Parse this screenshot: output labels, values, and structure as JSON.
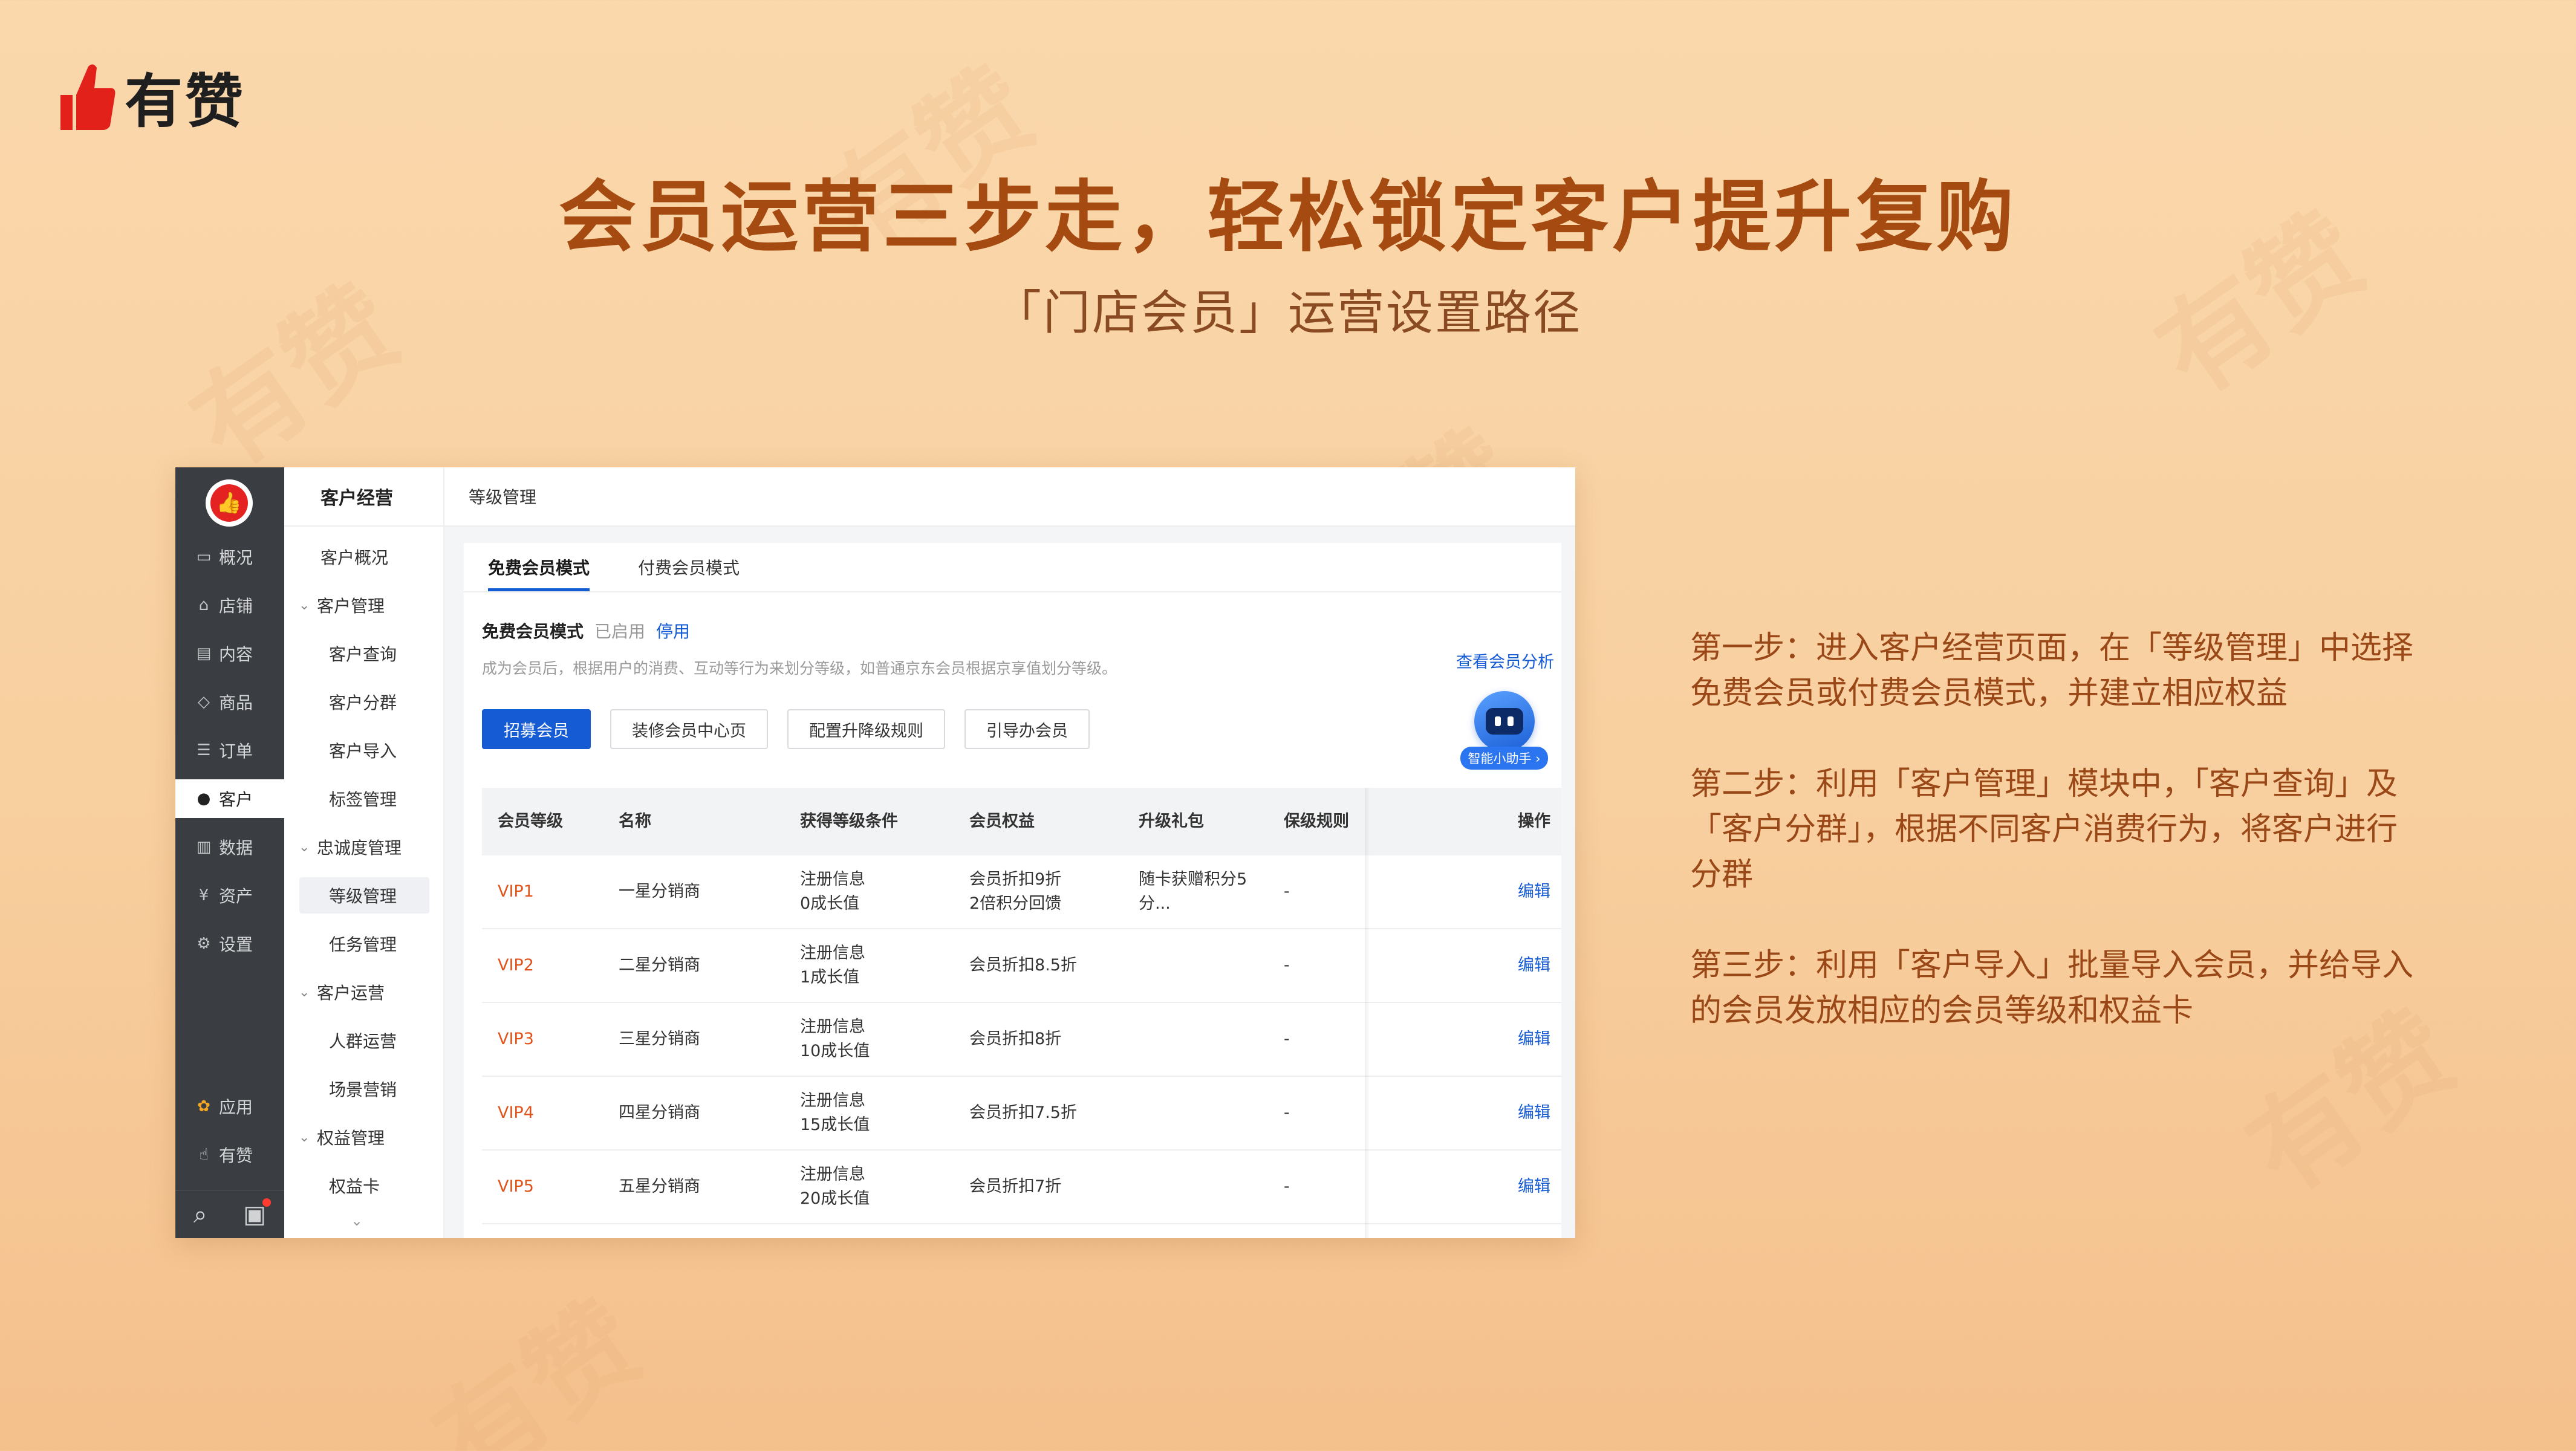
{
  "brand": {
    "name": "有赞",
    "watermark": "有赞"
  },
  "headline": "会员运营三步走，轻松锁定客户提升复购",
  "subhead": "「门店会员」运营设置路径",
  "rail": {
    "items": [
      {
        "label": "概况",
        "icon": "monitor-icon"
      },
      {
        "label": "店铺",
        "icon": "store-icon"
      },
      {
        "label": "内容",
        "icon": "document-icon"
      },
      {
        "label": "商品",
        "icon": "tag-icon"
      },
      {
        "label": "订单",
        "icon": "list-icon"
      },
      {
        "label": "客户",
        "icon": "user-icon"
      },
      {
        "label": "数据",
        "icon": "bar-chart-icon"
      },
      {
        "label": "资产",
        "icon": "yen-icon"
      },
      {
        "label": "设置",
        "icon": "gear-icon"
      },
      {
        "label": "应用",
        "icon": "apps-icon"
      },
      {
        "label": "有赞",
        "icon": "thumb-icon"
      }
    ],
    "active": "客户"
  },
  "subnav": {
    "title": "客户经营",
    "items": [
      "客户概况",
      "客户管理",
      "客户查询",
      "客户分群",
      "客户导入",
      "标签管理",
      "忠诚度管理",
      "等级管理",
      "任务管理",
      "客户运营",
      "人群运营",
      "场景营销",
      "权益管理",
      "权益卡"
    ]
  },
  "page": {
    "breadcrumb": "等级管理",
    "tabs": [
      "免费会员模式",
      "付费会员模式"
    ],
    "mode": {
      "title": "免费会员模式",
      "status": "已启用",
      "action": "停用"
    },
    "description": "成为会员后，根据用户的消费、互动等行为来划分等级，如普通京东会员根据京享值划分等级。",
    "analysis_link": "查看会员分析",
    "buttons": [
      "招募会员",
      "装修会员中心页",
      "配置升降级规则",
      "引导办会员"
    ],
    "assistant_label": "智能小助手 ›"
  },
  "table": {
    "headers": [
      "会员等级",
      "名称",
      "获得等级条件",
      "会员权益",
      "升级礼包",
      "保级规则",
      "操作"
    ],
    "rows": [
      {
        "level": "VIP1",
        "name": "一星分销商",
        "cond1": "注册信息",
        "cond2": "0成长值",
        "benefit1": "会员折扣9折",
        "benefit2": "2倍积分回馈",
        "gift1": "随卡获赠积分5",
        "gift2": "分...",
        "keep": "-",
        "op": "编辑"
      },
      {
        "level": "VIP2",
        "name": "二星分销商",
        "cond1": "注册信息",
        "cond2": "1成长值",
        "benefit1": "会员折扣8.5折",
        "benefit2": "",
        "gift1": "",
        "gift2": "",
        "keep": "-",
        "op": "编辑"
      },
      {
        "level": "VIP3",
        "name": "三星分销商",
        "cond1": "注册信息",
        "cond2": "10成长值",
        "benefit1": "会员折扣8折",
        "benefit2": "",
        "gift1": "",
        "gift2": "",
        "keep": "-",
        "op": "编辑"
      },
      {
        "level": "VIP4",
        "name": "四星分销商",
        "cond1": "注册信息",
        "cond2": "15成长值",
        "benefit1": "会员折扣7.5折",
        "benefit2": "",
        "gift1": "",
        "gift2": "",
        "keep": "-",
        "op": "编辑"
      },
      {
        "level": "VIP5",
        "name": "五星分销商",
        "cond1": "注册信息",
        "cond2": "20成长值",
        "benefit1": "会员折扣7折",
        "benefit2": "",
        "gift1": "",
        "gift2": "",
        "keep": "-",
        "op": "编辑"
      }
    ]
  },
  "steps": [
    "第一步：进入客户经营页面，在「等级管理」中选择免费会员或付费会员模式，并建立相应权益",
    "第二步：利用「客户管理」模块中，「客户查询」及「客户分群」，根据不同客户消费行为，将客户进行分群",
    "第三步：利用「客户导入」批量导入会员，并给导入的会员发放相应的会员等级和权益卡"
  ]
}
